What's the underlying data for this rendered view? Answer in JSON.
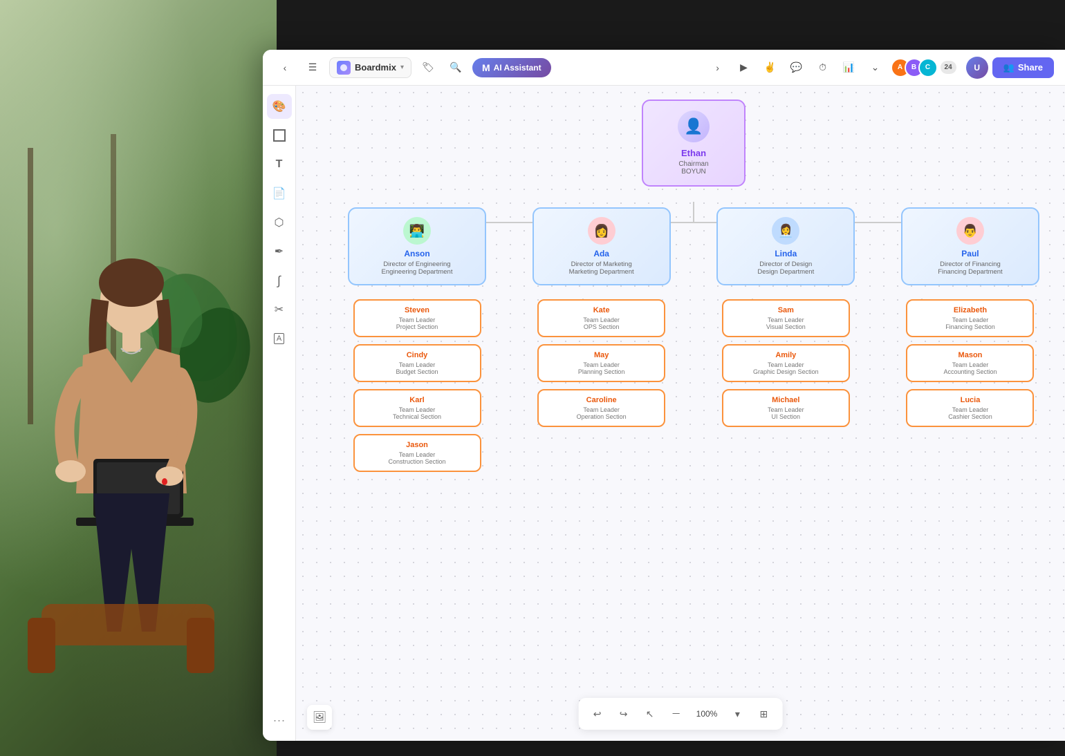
{
  "app": {
    "title": "Boardmix",
    "back_label": "←",
    "menu_label": "≡",
    "search_label": "🔍",
    "ai_label": "AI Assistant",
    "share_label": "Share",
    "zoom": "100%",
    "avatar_count": "24"
  },
  "toolbar": {
    "tools": [
      {
        "name": "palette",
        "icon": "🎨",
        "active": true
      },
      {
        "name": "frame",
        "icon": "⬜"
      },
      {
        "name": "text",
        "icon": "T"
      },
      {
        "name": "sticky",
        "icon": "📝"
      },
      {
        "name": "shape",
        "icon": "⬡"
      },
      {
        "name": "pen",
        "icon": "✒"
      },
      {
        "name": "curve",
        "icon": "〜"
      },
      {
        "name": "eraser",
        "icon": "✂"
      },
      {
        "name": "badge",
        "icon": "🏷"
      },
      {
        "name": "more",
        "icon": "•••"
      }
    ]
  },
  "orgchart": {
    "root": {
      "name": "Ethan",
      "role": "Chairman",
      "dept": "BOYUN",
      "emoji": "👤"
    },
    "level2": [
      {
        "name": "Anson",
        "role": "Director of Engineering",
        "dept": "Engineering Department",
        "emoji": "👨‍💻",
        "avatar_bg": "#bbf7d0"
      },
      {
        "name": "Ada",
        "role": "Director of Marketing",
        "dept": "Marketing Department",
        "emoji": "👩",
        "avatar_bg": "#fecdd3"
      },
      {
        "name": "Linda",
        "role": "Director of Design",
        "dept": "Design Department",
        "emoji": "👩‍💼",
        "avatar_bg": "#bfdbfe"
      },
      {
        "name": "Paul",
        "role": "Director of Financing",
        "dept": "Financing Department",
        "emoji": "👨",
        "avatar_bg": "#fecdd3"
      }
    ],
    "level3": [
      [
        {
          "name": "Steven",
          "role": "Team Leader",
          "dept": "Project Section"
        },
        {
          "name": "Cindy",
          "role": "Team Leader",
          "dept": "Budget Section"
        },
        {
          "name": "Karl",
          "role": "Team Leader",
          "dept": "Technical Section"
        },
        {
          "name": "Jason",
          "role": "Team Leader",
          "dept": "Construction Section"
        }
      ],
      [
        {
          "name": "Kate",
          "role": "Team Leader",
          "dept": "OPS Section"
        },
        {
          "name": "May",
          "role": "Team Leader",
          "dept": "Planning Section"
        },
        {
          "name": "Caroline",
          "role": "Team Leader",
          "dept": "Operation Section"
        }
      ],
      [
        {
          "name": "Sam",
          "role": "Team Leader",
          "dept": "Visual Section"
        },
        {
          "name": "Amily",
          "role": "Team Leader",
          "dept": "Graphic Design Section"
        },
        {
          "name": "Michael",
          "role": "Team Leader",
          "dept": "UI Section"
        }
      ],
      [
        {
          "name": "Elizabeth",
          "role": "Team Leader",
          "dept": "Financing Section"
        },
        {
          "name": "Mason",
          "role": "Team Leader",
          "dept": "Accounting Section"
        },
        {
          "name": "Lucia",
          "role": "Team Leader",
          "dept": "Cashier Section"
        }
      ]
    ]
  }
}
